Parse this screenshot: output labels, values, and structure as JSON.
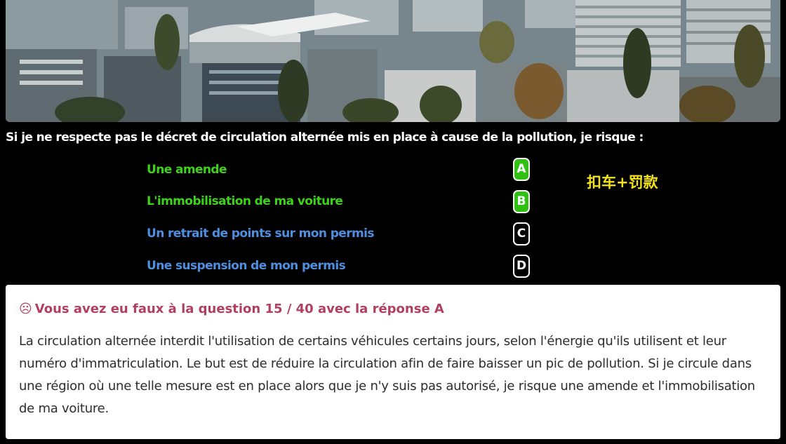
{
  "question": {
    "text": "Si je ne respecte pas le décret de circulation alternée mis en place à cause de la pollution, je risque :"
  },
  "answers": [
    {
      "letter": "A",
      "text": "Une amende",
      "state": "correct-selected"
    },
    {
      "letter": "B",
      "text": "L'immobilisation de ma voiture",
      "state": "correct-selected"
    },
    {
      "letter": "C",
      "text": "Un retrait de points sur mon permis",
      "state": "unselected"
    },
    {
      "letter": "D",
      "text": "Une suspension de mon permis",
      "state": "unselected"
    }
  ],
  "note": "扣车+罚款",
  "feedback": {
    "icon": "sad-face-icon",
    "icon_glyph": "☹",
    "title": "Vous avez eu faux à la question 15 / 40 avec la réponse A",
    "explanation": "La circulation alternée interdit l'utilisation de certains véhicules certains jours, selon l'énergie qu'ils utilisent et leur numéro d'immatriculation. Le but est de réduire la circulation afin de faire baisser un pic de pollution. Si je circule dans une région où une telle mesure est en place alors que je n'y suis pas autorisé, je risque une amende et l'immobilisation de ma voiture."
  },
  "colors": {
    "correct_text": "#3fd21a",
    "normal_text": "#4f8fe0",
    "selected_badge": "#2fc012",
    "note": "#f3e21a",
    "feedback_title": "#b0405f"
  }
}
